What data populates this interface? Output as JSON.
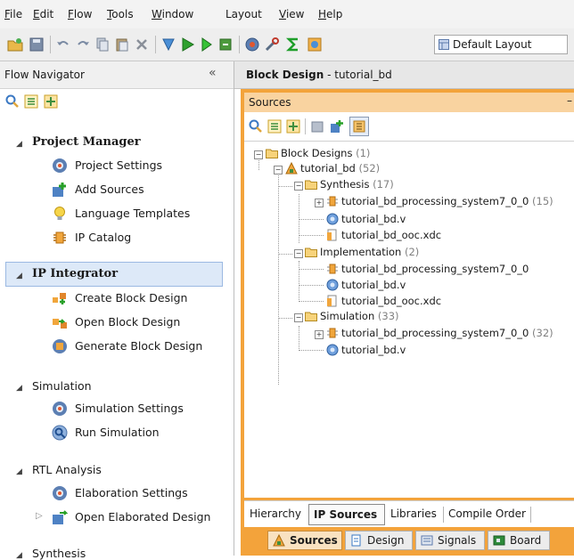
{
  "menu": {
    "items": [
      {
        "u": "F",
        "rest": "ile"
      },
      {
        "u": "E",
        "rest": "dit"
      },
      {
        "u": "F",
        "rest": "low"
      },
      {
        "u": "T",
        "rest": "ools"
      },
      {
        "u": "W",
        "rest": "indow"
      },
      {
        "u": "",
        "rest": "Layout"
      },
      {
        "u": "V",
        "rest": "iew"
      },
      {
        "u": "H",
        "rest": "elp"
      }
    ]
  },
  "toolbar": {
    "layout_value": "Default Layout"
  },
  "flow_navigator": {
    "title": "Flow Navigator",
    "collapse": "«",
    "sections": {
      "project_manager": "Project Manager",
      "ip_integrator": "IP Integrator",
      "simulation": "Simulation",
      "rtl_analysis": "RTL Analysis",
      "synthesis": "Synthesis"
    },
    "items": {
      "project_settings": "Project Settings",
      "add_sources": "Add Sources",
      "language_templates": "Language Templates",
      "ip_catalog": "IP Catalog",
      "create_block_design": "Create Block Design",
      "open_block_design": "Open Block Design",
      "generate_block_design": "Generate Block Design",
      "simulation_settings": "Simulation Settings",
      "run_simulation": "Run Simulation",
      "elaboration_settings": "Elaboration Settings",
      "open_elaborated_design": "Open Elaborated Design"
    }
  },
  "block_design": {
    "title": "Block Design",
    "separator": " - ",
    "name": "tutorial_bd"
  },
  "sources_panel": {
    "title": "Sources",
    "minimize": "–"
  },
  "tree": {
    "block_designs": {
      "label": "Block Designs",
      "count": " (1)"
    },
    "tutorial_bd": {
      "label": "tutorial_bd",
      "count": " (52)"
    },
    "synthesis": {
      "label": "Synthesis",
      "count": " (17)"
    },
    "syn_ps7": {
      "label": "tutorial_bd_processing_system7_0_0",
      "count": " (15)"
    },
    "syn_bdv": {
      "label": "tutorial_bd.v"
    },
    "syn_xdc": {
      "label": "tutorial_bd_ooc.xdc"
    },
    "implementation": {
      "label": "Implementation",
      "count": " (2)"
    },
    "imp_ps7": {
      "label": "tutorial_bd_processing_system7_0_0"
    },
    "imp_bdv": {
      "label": "tutorial_bd.v"
    },
    "imp_xdc": {
      "label": "tutorial_bd_ooc.xdc"
    },
    "simulation": {
      "label": "Simulation",
      "count": " (33)"
    },
    "sim_ps7": {
      "label": "tutorial_bd_processing_system7_0_0",
      "count": " (32)"
    },
    "sim_bdv": {
      "label": "tutorial_bd.v"
    }
  },
  "subtabs": {
    "hierarchy": "Hierarchy",
    "ip_sources": "IP Sources",
    "libraries": "Libraries",
    "compile_order": "Compile Order"
  },
  "bottom_tabs": {
    "sources": "Sources",
    "design": "Design",
    "signals": "Signals",
    "board": "Board"
  }
}
